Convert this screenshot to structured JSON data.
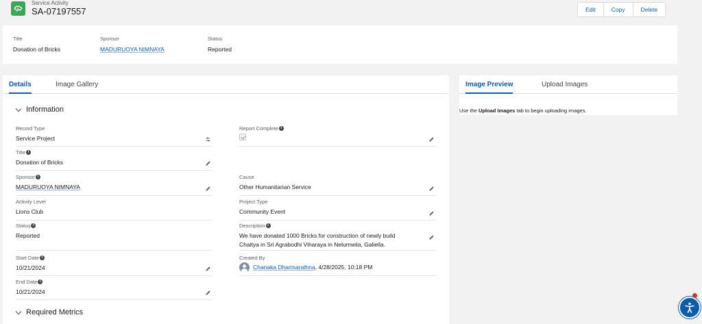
{
  "header": {
    "object_label": "Service Activity",
    "record_number": "SA-07197557",
    "icon": "handshake-icon",
    "icon_color": "#3ba755",
    "buttons": {
      "edit": "Edit",
      "copy": "Copy",
      "delete": "Delete"
    }
  },
  "highlights": {
    "title_label": "Title",
    "title_value": "Donation of Bricks",
    "sponsor_label": "Sponsor",
    "sponsor_value": "MADURUOYA NIMNAYA",
    "status_label": "Status",
    "status_value": "Reported"
  },
  "main_tabs": {
    "details": "Details",
    "gallery": "Image Gallery"
  },
  "sections": {
    "information": "Information",
    "required_metrics": "Required Metrics"
  },
  "fields": {
    "record_type": {
      "label": "Record Type",
      "value": "Service Project"
    },
    "title": {
      "label": "Title",
      "value": "Donation of Bricks"
    },
    "sponsor": {
      "label": "Sponsor",
      "value": "MADURUOYA NIMNAYA"
    },
    "activity_level": {
      "label": "Activity Level",
      "value": "Lions Club"
    },
    "status": {
      "label": "Status",
      "value": "Reported"
    },
    "start_date": {
      "label": "Start Date",
      "value": "10/21/2024"
    },
    "end_date": {
      "label": "End Date",
      "value": "10/21/2024"
    },
    "report_complete": {
      "label": "Report Complete",
      "checked": true
    },
    "cause": {
      "label": "Cause",
      "value": "Other Humanitarian Service"
    },
    "project_type": {
      "label": "Project Type",
      "value": "Community Event"
    },
    "description": {
      "label": "Description",
      "line1": "We have donated 1000 Bricks for construction of newly build",
      "line2": "Chaitya in Sri Agrabodhi Viharaya in Nelumwila, Galiella."
    },
    "created_by": {
      "label": "Created By",
      "user": "Chanaka Dharmarathna",
      "date": ", 4/28/2025, 10:18 PM"
    }
  },
  "side": {
    "tab_preview": "Image Preview",
    "tab_upload": "Upload Images",
    "text_prefix": "Use the ",
    "text_bold": "Upload Images",
    "text_suffix": " tab to begin uploading images."
  },
  "colors": {
    "brand": "#0b5cab",
    "background": "#f3f2f2"
  }
}
